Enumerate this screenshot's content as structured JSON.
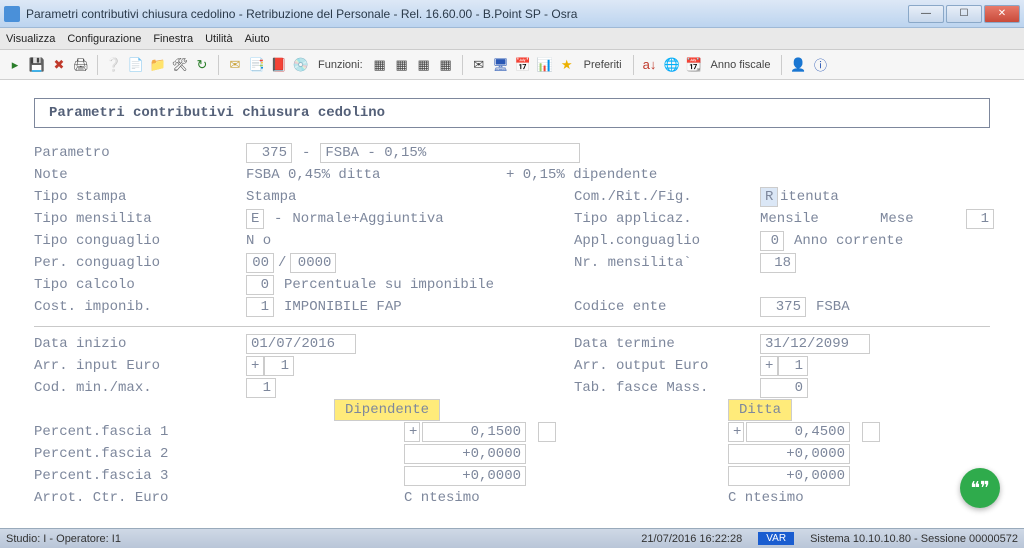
{
  "window": {
    "title": "Parametri contributivi chiusura cedolino - Retribuzione del Personale - Rel. 16.60.00 - B.Point SP - Osra",
    "min": "—",
    "max": "☐",
    "close": "✕"
  },
  "menu": {
    "visualizza": "Visualizza",
    "configurazione": "Configurazione",
    "finestra": "Finestra",
    "utilita": "Utilità",
    "aiuto": "Aiuto"
  },
  "toolbar": {
    "funzioni": "Funzioni:",
    "preferiti": "Preferiti",
    "anno_fiscale": "Anno fiscale"
  },
  "form": {
    "title": "Parametri contributivi chiusura cedolino",
    "parametro_lbl": "Parametro",
    "parametro_cod": "375",
    "parametro_desc": "FSBA - 0,15%",
    "note_lbl": "Note",
    "note_a": "FSBA 0,45% ditta",
    "note_b": "+ 0,15% dipendente",
    "tipo_stampa_lbl": "Tipo stampa",
    "tipo_stampa_val": "Stampa",
    "com_lbl": "Com./Rit./Fig.",
    "com_code": "R",
    "com_val": "itenuta",
    "tipo_mensilita_lbl": "Tipo mensilita",
    "tipo_mensilita_cod": "E",
    "tipo_mensilita_val": "Normale+Aggiuntiva",
    "tipo_applicaz_lbl": "Tipo applicaz.",
    "tipo_applicaz_val": "Mensile",
    "mese_lbl": "Mese",
    "mese_val": "1",
    "tipo_conguaglio_lbl": "Tipo conguaglio",
    "tipo_conguaglio_val": "N o",
    "appl_cong_lbl": "Appl.conguaglio",
    "appl_cong_cod": "0",
    "appl_cong_val": "Anno corrente",
    "per_cong_lbl": "Per. conguaglio",
    "per_cong_a": "00",
    "per_cong_b": "0000",
    "nr_mens_lbl": "Nr. mensilita`",
    "nr_mens_val": "18",
    "tipo_calc_lbl": "Tipo calcolo",
    "tipo_calc_cod": "0",
    "tipo_calc_val": "Percentuale su imponibile",
    "cost_imp_lbl": "Cost. imponib.",
    "cost_imp_cod": "1",
    "cost_imp_val": "IMPONIBILE FAP",
    "cod_ente_lbl": "Codice ente",
    "cod_ente_cod": "375",
    "cod_ente_val": "FSBA",
    "data_inizio_lbl": "Data inizio",
    "data_inizio_val": "01/07/2016",
    "data_termine_lbl": "Data termine",
    "data_termine_val": "31/12/2099",
    "arr_input_lbl": "Arr. input Euro",
    "arr_input_sign": "+",
    "arr_input_val": "1",
    "arr_output_lbl": "Arr. output Euro",
    "arr_output_sign": "+",
    "arr_output_val": "1",
    "cod_min_lbl": "Cod. min./max.",
    "cod_min_val": "1",
    "tab_fasce_lbl": "Tab. fasce Mass.",
    "tab_fasce_val": "0",
    "dipendente": "Dipendente",
    "ditta": "Ditta",
    "pf1_lbl": "Percent.fascia 1",
    "pf2_lbl": "Percent.fascia 2",
    "pf3_lbl": "Percent.fascia 3",
    "pf1_dip_sign": "+",
    "pf1_dip": "0,1500",
    "pf2_dip": "+0,0000",
    "pf3_dip": "+0,0000",
    "pf1_dit_sign": "+",
    "pf1_dit": "0,4500",
    "pf2_dit": "+0,0000",
    "pf3_dit": "+0,0000",
    "arr_ctr_lbl": "Arrot. Ctr. Euro",
    "centesimo": "C ntesimo"
  },
  "status": {
    "studio": "Studio: I - Operatore: I1",
    "datetime": "21/07/2016   16:22:28",
    "var": "VAR",
    "session": "Sistema 10.10.10.80 - Sessione 00000572"
  }
}
